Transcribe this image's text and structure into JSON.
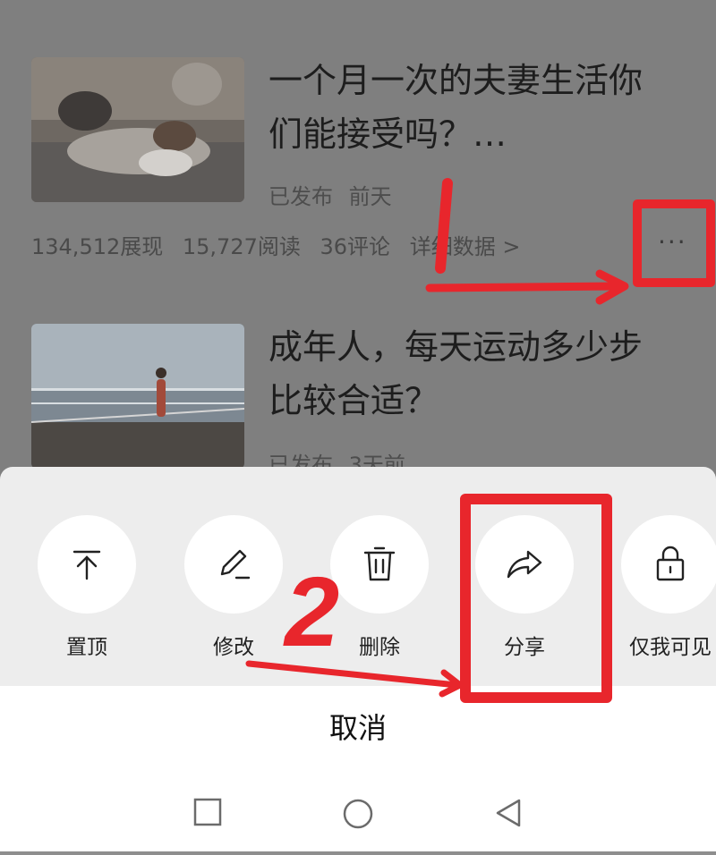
{
  "articles": [
    {
      "title_line1": "一个月一次的夫妻生活你",
      "title_line2": "们能接受吗？…",
      "status": "已发布",
      "time": "前天",
      "stats": {
        "impressions": "134,512展现",
        "reads": "15,727阅读",
        "comments": "36评论",
        "details": "详细数据 >"
      },
      "more": "···"
    },
    {
      "title_line1": "成年人，每天运动多少步",
      "title_line2": "比较合适？",
      "status": "已发布",
      "time": "3天前"
    }
  ],
  "action_sheet": {
    "actions": [
      {
        "label": "置顶",
        "icon": "pin-top-icon"
      },
      {
        "label": "修改",
        "icon": "pencil-icon"
      },
      {
        "label": "删除",
        "icon": "trash-icon"
      },
      {
        "label": "分享",
        "icon": "share-arrow-icon"
      },
      {
        "label": "仅我可见",
        "icon": "lock-icon"
      }
    ],
    "cancel": "取消"
  },
  "annotations": {
    "step1": "1",
    "step2": "2",
    "color": "#e8262c"
  },
  "navbar": {
    "icons": [
      "square-recents-icon",
      "circle-home-icon",
      "triangle-back-icon"
    ]
  }
}
